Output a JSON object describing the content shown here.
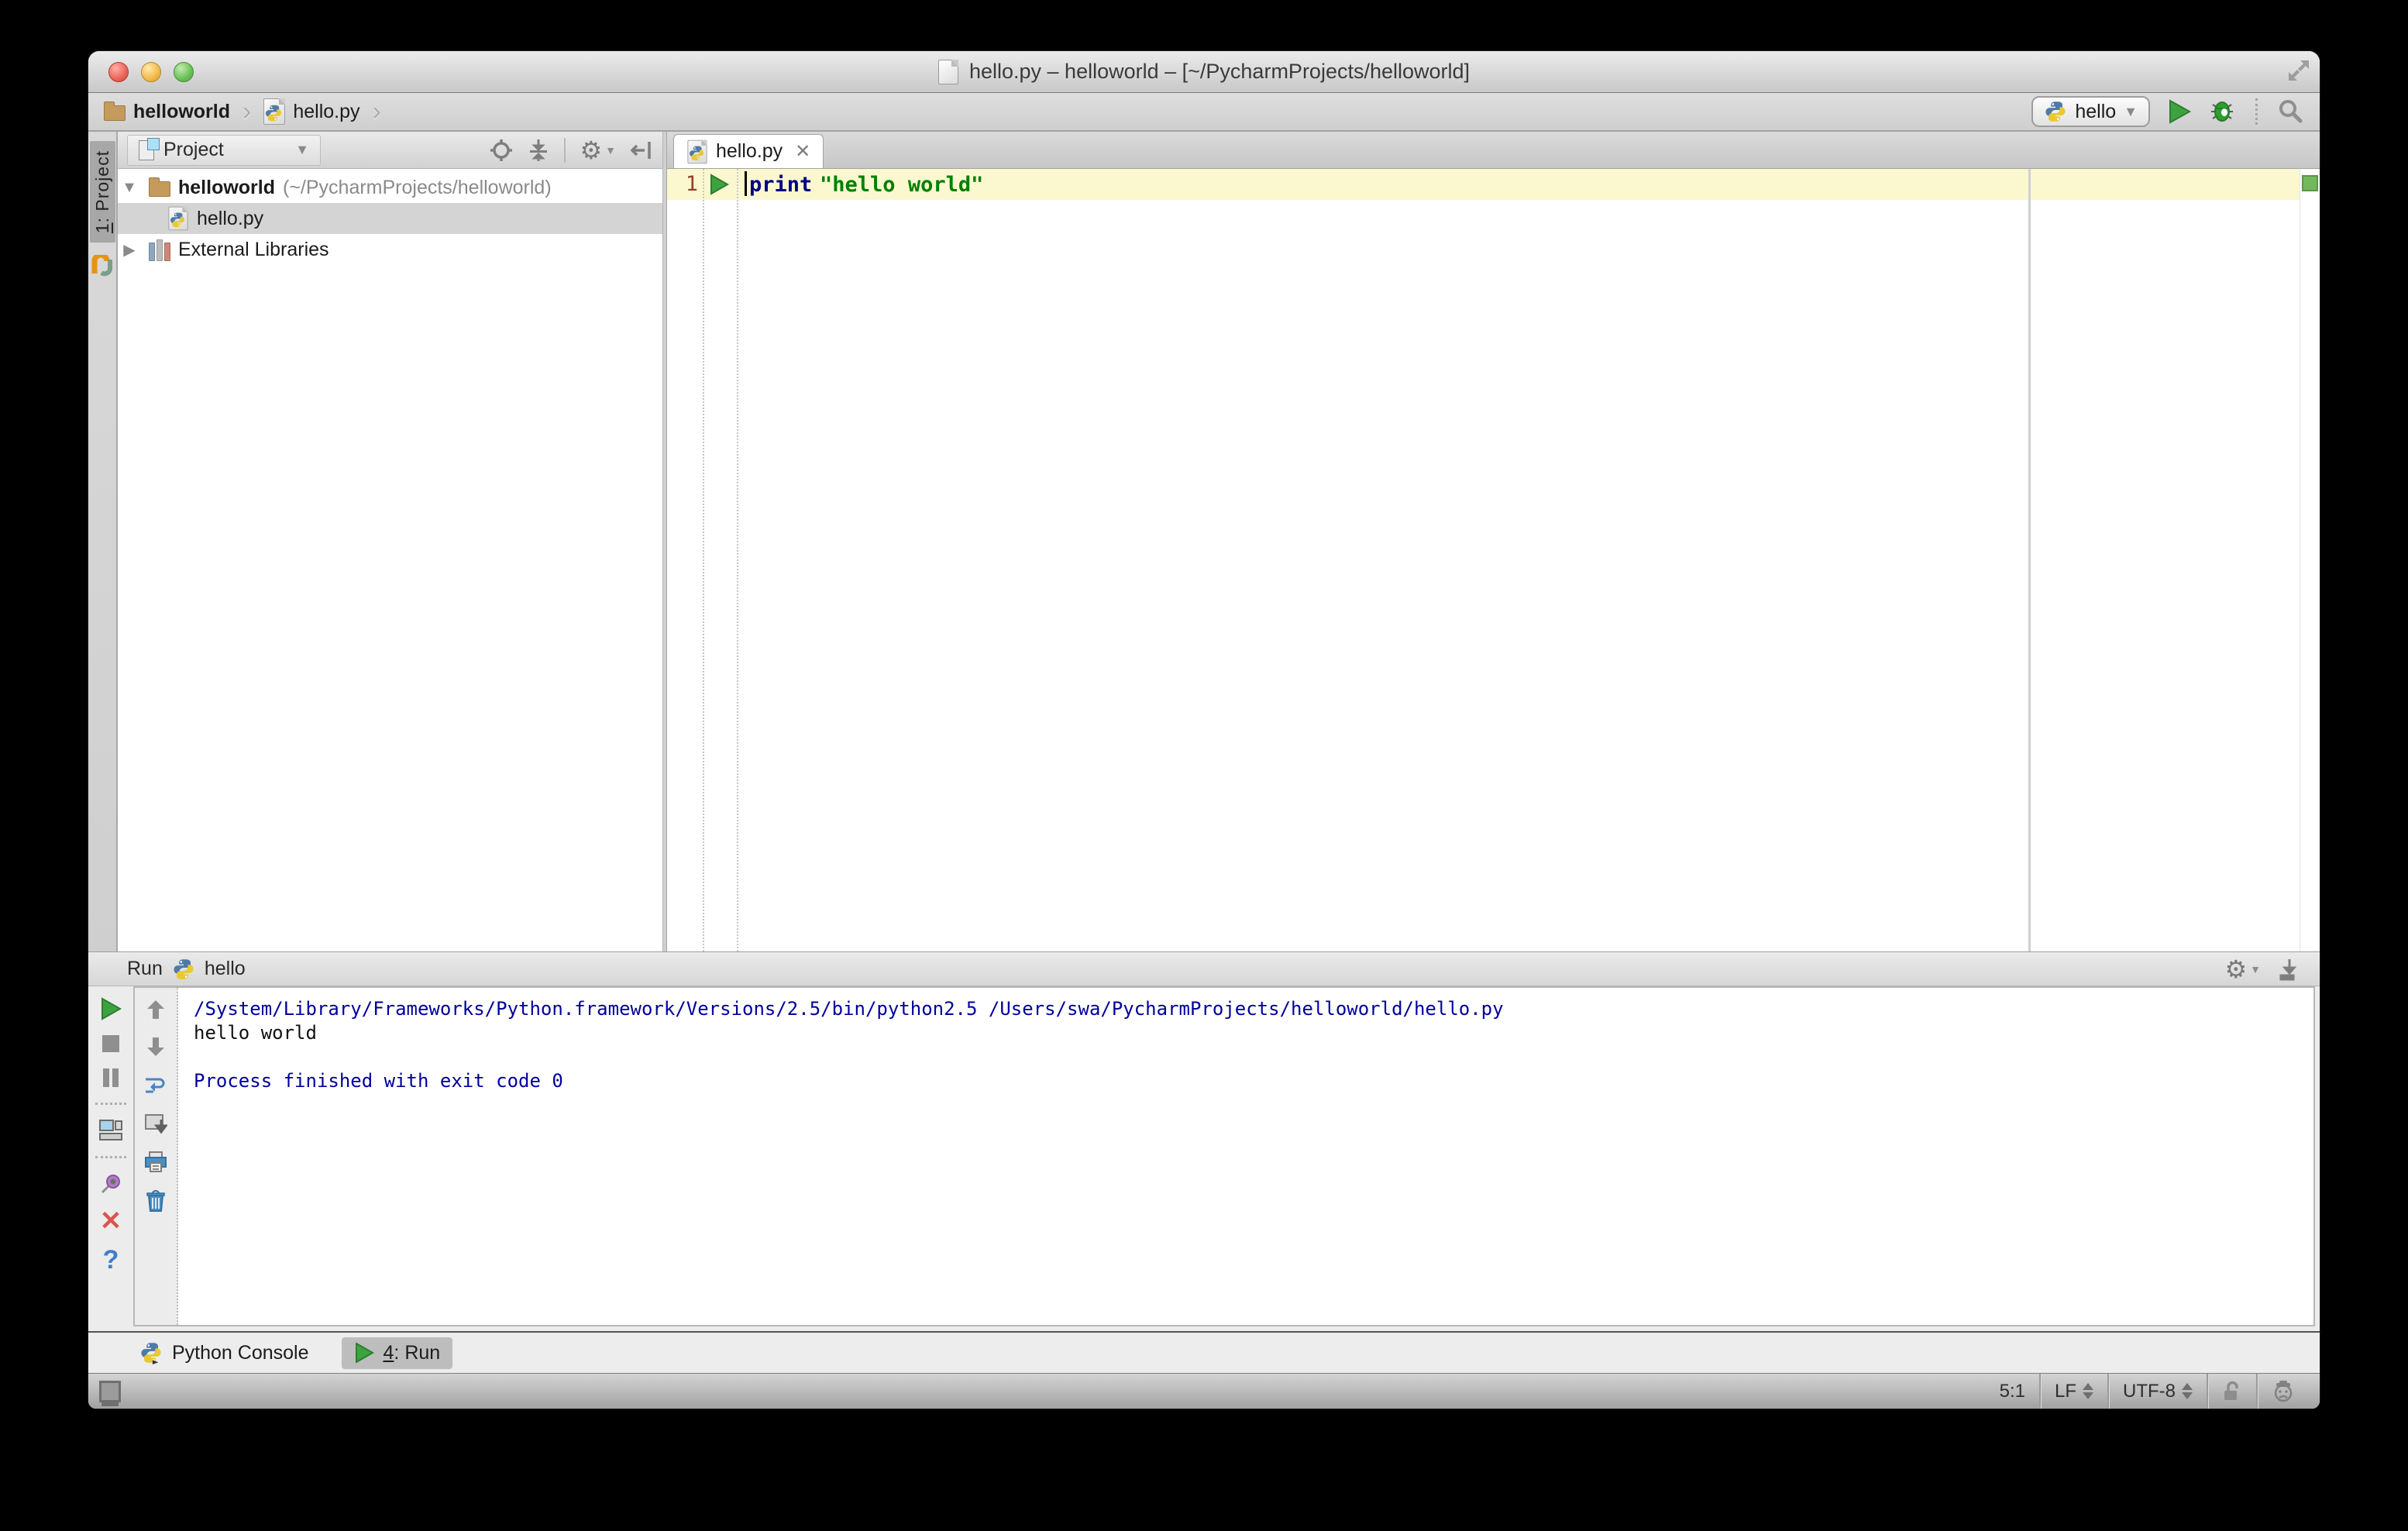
{
  "window": {
    "title": "hello.py – helloworld – [~/PycharmProjects/helloworld]"
  },
  "navbar": {
    "breadcrumb_project": "helloworld",
    "breadcrumb_file": "hello.py",
    "run_config": "hello"
  },
  "project_panel": {
    "stripe_tab_num": "1",
    "stripe_tab_label": ": Project",
    "header_label": "Project",
    "tree": {
      "root_name": "helloworld",
      "root_path": "(~/PycharmProjects/helloworld)",
      "file": "hello.py",
      "libraries": "External Libraries"
    }
  },
  "editor": {
    "tab_label": "hello.py",
    "close_glyph": "✕",
    "line_number": "1",
    "keyword": "print",
    "string": "\"hello world\""
  },
  "run_panel": {
    "title": "Run",
    "config_name": "hello",
    "lines": [
      {
        "text": "/System/Library/Frameworks/Python.framework/Versions/2.5/bin/python2.5 /Users/swa/PycharmProjects/helloworld/hello.py"
      },
      {
        "text": "hello world"
      },
      {
        "text": ""
      },
      {
        "text": "Process finished with exit code 0"
      }
    ]
  },
  "bottom_bar": {
    "python_console": "Python Console",
    "run_num": "4",
    "run_label": ": Run"
  },
  "status_bar": {
    "caret_position": "5:1",
    "line_separator": "LF",
    "encoding": "UTF-8"
  },
  "colors": {
    "accent_green": "#3da33f",
    "keyword_blue": "#000080",
    "string_green": "#008000",
    "console_blue": "#00009C",
    "current_line_yellow": "#FBF8D0",
    "selection_gray": "#d4d4d4"
  },
  "glyphs": {
    "gear": "⚙",
    "chevron": "›",
    "dropdown": "▼",
    "tree_open": "▼",
    "tree_closed": "▶",
    "close_x": "✕",
    "help_q": "?"
  }
}
